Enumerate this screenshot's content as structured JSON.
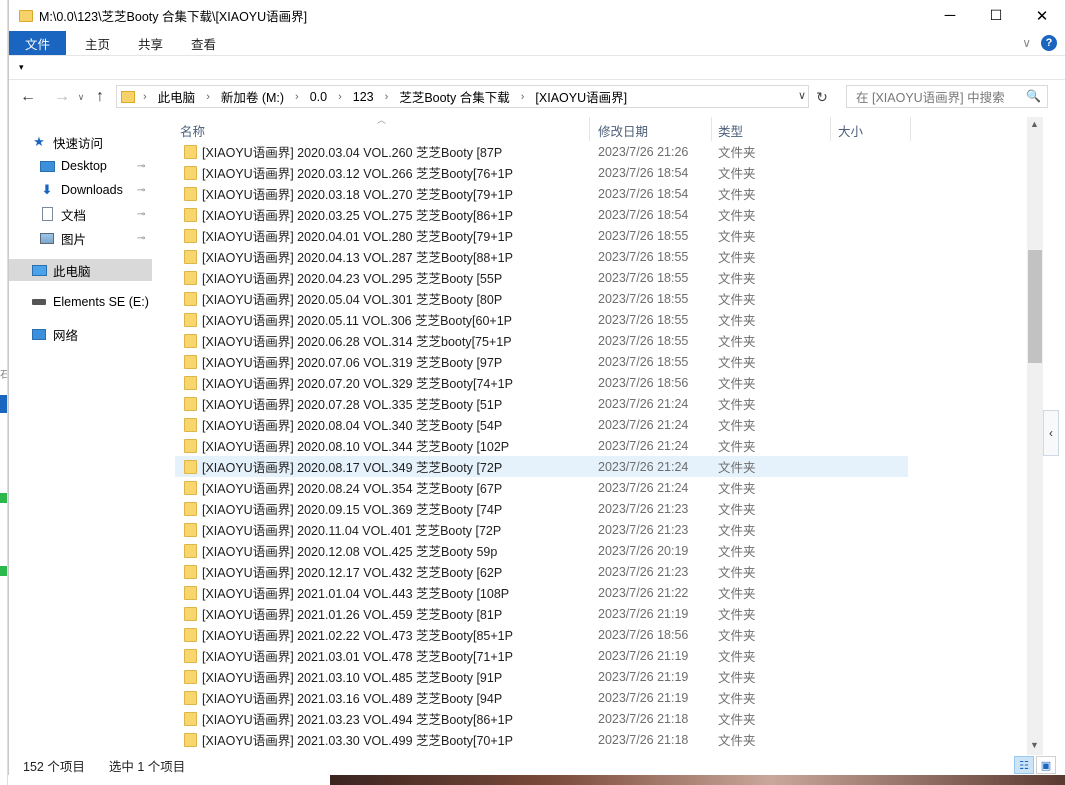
{
  "window": {
    "title": "M:\\0.0\\123\\芝芝Booty 合集下载\\[XIAOYU语画界]",
    "min": "─",
    "max": "☐",
    "close": "✕"
  },
  "ribbon": {
    "tabs": [
      "文件",
      "主页",
      "共享",
      "查看"
    ],
    "expand": "∨",
    "help": "?"
  },
  "qat": {
    "caret": "▾"
  },
  "nav_buttons": {
    "back": "←",
    "forward": "→",
    "recent": "∨",
    "up": "↑"
  },
  "address": {
    "lead": "›",
    "crumbs": [
      "此电脑",
      "新加卷 (M:)",
      "0.0",
      "123",
      "芝芝Booty 合集下载",
      "[XIAOYU语画界]"
    ],
    "separator": "›",
    "dropdown": "∨",
    "refresh": "↻"
  },
  "search": {
    "placeholder": "在 [XIAOYU语画界] 中搜索",
    "icon": "🔍"
  },
  "nav_pane": {
    "quick_access": "快速访问",
    "desktop": "Desktop",
    "downloads": "Downloads",
    "documents": "文档",
    "pictures": "图片",
    "this_pc": "此电脑",
    "elements": "Elements SE (E:)",
    "network": "网络",
    "pin": "📌"
  },
  "columns": {
    "name": "名称",
    "date": "修改日期",
    "type": "类型",
    "size": "大小",
    "sort": "︿"
  },
  "rows": [
    {
      "name": "[XIAOYU语画界] 2020.03.04 VOL.260 芝芝Booty [87P",
      "date": "2023/7/26 21:26",
      "type": "文件夹"
    },
    {
      "name": "[XIAOYU语画界] 2020.03.12 VOL.266 芝芝Booty[76+1P",
      "date": "2023/7/26 18:54",
      "type": "文件夹"
    },
    {
      "name": "[XIAOYU语画界] 2020.03.18 VOL.270 芝芝Booty[79+1P",
      "date": "2023/7/26 18:54",
      "type": "文件夹"
    },
    {
      "name": "[XIAOYU语画界] 2020.03.25 VOL.275 芝芝Booty[86+1P",
      "date": "2023/7/26 18:54",
      "type": "文件夹"
    },
    {
      "name": "[XIAOYU语画界] 2020.04.01 VOL.280 芝芝Booty[79+1P",
      "date": "2023/7/26 18:55",
      "type": "文件夹"
    },
    {
      "name": "[XIAOYU语画界] 2020.04.13 VOL.287 芝芝Booty[88+1P",
      "date": "2023/7/26 18:55",
      "type": "文件夹"
    },
    {
      "name": "[XIAOYU语画界] 2020.04.23 VOL.295 芝芝Booty [55P",
      "date": "2023/7/26 18:55",
      "type": "文件夹"
    },
    {
      "name": "[XIAOYU语画界] 2020.05.04 VOL.301 芝芝Booty [80P",
      "date": "2023/7/26 18:55",
      "type": "文件夹"
    },
    {
      "name": "[XIAOYU语画界] 2020.05.11 VOL.306 芝芝Booty[60+1P",
      "date": "2023/7/26 18:55",
      "type": "文件夹"
    },
    {
      "name": "[XIAOYU语画界] 2020.06.28 VOL.314 芝芝booty[75+1P",
      "date": "2023/7/26 18:55",
      "type": "文件夹"
    },
    {
      "name": "[XIAOYU语画界] 2020.07.06 VOL.319 芝芝Booty [97P",
      "date": "2023/7/26 18:55",
      "type": "文件夹"
    },
    {
      "name": "[XIAOYU语画界] 2020.07.20 VOL.329 芝芝Booty[74+1P",
      "date": "2023/7/26 18:56",
      "type": "文件夹"
    },
    {
      "name": "[XIAOYU语画界] 2020.07.28 VOL.335 芝芝Booty [51P",
      "date": "2023/7/26 21:24",
      "type": "文件夹"
    },
    {
      "name": "[XIAOYU语画界] 2020.08.04 VOL.340 芝芝Booty [54P",
      "date": "2023/7/26 21:24",
      "type": "文件夹"
    },
    {
      "name": "[XIAOYU语画界] 2020.08.10 VOL.344 芝芝Booty [102P",
      "date": "2023/7/26 21:24",
      "type": "文件夹"
    },
    {
      "name": "[XIAOYU语画界] 2020.08.17 VOL.349 芝芝Booty [72P",
      "date": "2023/7/26 21:24",
      "type": "文件夹",
      "selected": true
    },
    {
      "name": "[XIAOYU语画界] 2020.08.24 VOL.354 芝芝Booty [67P",
      "date": "2023/7/26 21:24",
      "type": "文件夹"
    },
    {
      "name": "[XIAOYU语画界] 2020.09.15 VOL.369 芝芝Booty [74P",
      "date": "2023/7/26 21:23",
      "type": "文件夹"
    },
    {
      "name": "[XIAOYU语画界] 2020.11.04 VOL.401 芝芝Booty [72P",
      "date": "2023/7/26 21:23",
      "type": "文件夹"
    },
    {
      "name": "[XIAOYU语画界] 2020.12.08 VOL.425 芝芝Booty 59p",
      "date": "2023/7/26 20:19",
      "type": "文件夹"
    },
    {
      "name": "[XIAOYU语画界] 2020.12.17 VOL.432 芝芝Booty [62P",
      "date": "2023/7/26 21:23",
      "type": "文件夹"
    },
    {
      "name": "[XIAOYU语画界] 2021.01.04 VOL.443 芝芝Booty [108P",
      "date": "2023/7/26 21:22",
      "type": "文件夹"
    },
    {
      "name": "[XIAOYU语画界] 2021.01.26 VOL.459 芝芝Booty [81P",
      "date": "2023/7/26 21:19",
      "type": "文件夹"
    },
    {
      "name": "[XIAOYU语画界] 2021.02.22 VOL.473 芝芝Booty[85+1P",
      "date": "2023/7/26 18:56",
      "type": "文件夹"
    },
    {
      "name": "[XIAOYU语画界] 2021.03.01 VOL.478 芝芝Booty[71+1P",
      "date": "2023/7/26 21:19",
      "type": "文件夹"
    },
    {
      "name": "[XIAOYU语画界] 2021.03.10 VOL.485 芝芝Booty [91P",
      "date": "2023/7/26 21:19",
      "type": "文件夹"
    },
    {
      "name": "[XIAOYU语画界] 2021.03.16 VOL.489 芝芝Booty [94P",
      "date": "2023/7/26 21:19",
      "type": "文件夹"
    },
    {
      "name": "[XIAOYU语画界] 2021.03.23 VOL.494 芝芝Booty[86+1P",
      "date": "2023/7/26 21:18",
      "type": "文件夹"
    },
    {
      "name": "[XIAOYU语画界] 2021.03.30 VOL.499 芝芝Booty[70+1P",
      "date": "2023/7/26 21:18",
      "type": "文件夹"
    }
  ],
  "scroll": {
    "up": "▲",
    "down": "▼"
  },
  "side_tab": "‹",
  "status": {
    "count": "152 个项目",
    "selection": "选中 1 个项目"
  },
  "view": {
    "details": "☷",
    "tiles": "▣"
  },
  "colors": {
    "accent": "#1a65c0",
    "selected_row": "#e5f1fb",
    "folder": "#f8d66e"
  }
}
